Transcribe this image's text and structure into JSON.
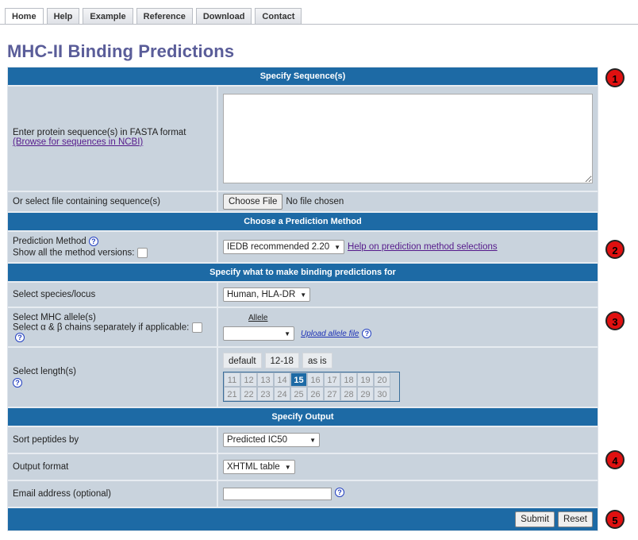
{
  "tabs": [
    "Home",
    "Help",
    "Example",
    "Reference",
    "Download",
    "Contact"
  ],
  "page_title": "MHC-II Binding Predictions",
  "sections": {
    "sequence": "Specify Sequence(s)",
    "method": "Choose a Prediction Method",
    "binding": "Specify what to make binding predictions for",
    "output": "Specify Output"
  },
  "sequence": {
    "fasta_label": "Enter protein sequence(s) in FASTA format",
    "ncbi_link": "(Browse for sequences in NCBI)",
    "file_label": "Or select file containing sequence(s)",
    "choose_file": "Choose File",
    "no_file": "No file chosen"
  },
  "method": {
    "label": "Prediction Method",
    "show_all": "Show all the method versions:",
    "selected": "IEDB recommended 2.20",
    "help_link": "Help on prediction method selections"
  },
  "binding": {
    "species_label": "Select species/locus",
    "species_value": "Human, HLA-DR",
    "allele_label": "Select MHC allele(s)",
    "chains_label": "Select α & β chains separately if applicable:",
    "allele_header": "Allele",
    "upload_link": "Upload allele file",
    "length_label": "Select length(s)",
    "length_buttons": [
      "default",
      "12-18",
      "as is"
    ],
    "lengths": [
      "11",
      "12",
      "13",
      "14",
      "15",
      "16",
      "17",
      "18",
      "19",
      "20",
      "21",
      "22",
      "23",
      "24",
      "25",
      "26",
      "27",
      "28",
      "29",
      "30"
    ],
    "selected_length": "15"
  },
  "output": {
    "sort_label": "Sort peptides by",
    "sort_value": "Predicted IC50",
    "format_label": "Output format",
    "format_value": "XHTML table",
    "email_label": "Email address (optional)"
  },
  "buttons": {
    "submit": "Submit",
    "reset": "Reset"
  },
  "markers": [
    "1",
    "2",
    "3",
    "4",
    "5"
  ],
  "help_icon": "?",
  "colors": {
    "header_blue": "#1d6aa5",
    "title": "#5a5d99",
    "panel": "#c9d3dd",
    "marker": "#e01010"
  }
}
